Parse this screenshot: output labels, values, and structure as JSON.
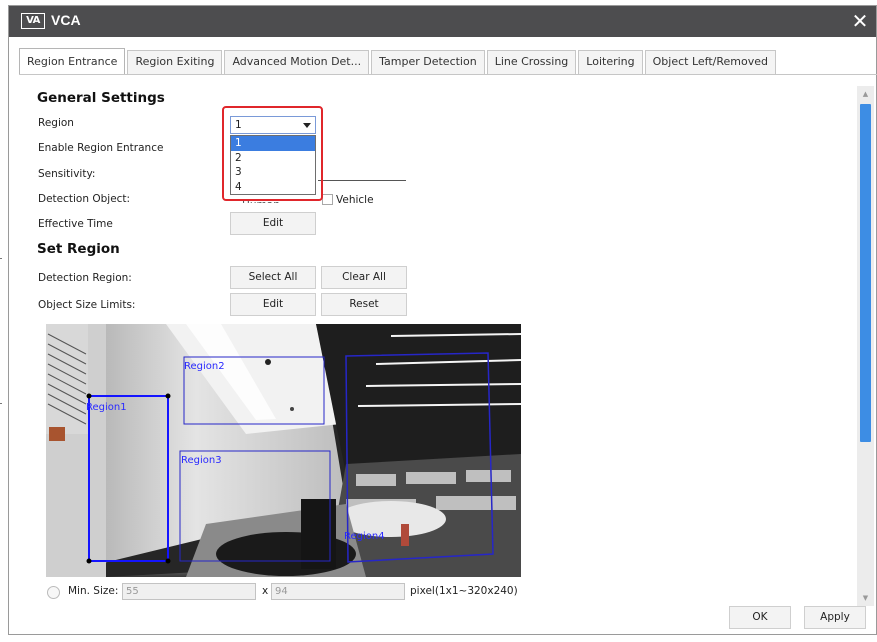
{
  "window": {
    "logo": "VA",
    "title": "VCA",
    "close_glyph": "✕"
  },
  "tabs": [
    {
      "label": "Region Entrance",
      "active": true
    },
    {
      "label": "Region Exiting",
      "active": false
    },
    {
      "label": "Advanced Motion Det...",
      "active": false
    },
    {
      "label": "Tamper Detection",
      "active": false
    },
    {
      "label": "Line Crossing",
      "active": false
    },
    {
      "label": "Loitering",
      "active": false
    },
    {
      "label": "Object Left/Removed",
      "active": false
    }
  ],
  "general": {
    "heading": "General Settings",
    "region_label": "Region",
    "region_value": "1",
    "region_options": [
      "1",
      "2",
      "3",
      "4"
    ],
    "enable_label": "Enable Region Entrance",
    "sensitivity_label": "Sensitivity:",
    "detection_object_label": "Detection Object:",
    "human_label": "Human",
    "vehicle_label": "Vehicle",
    "effective_time_label": "Effective Time",
    "edit_label": "Edit"
  },
  "set_region": {
    "heading": "Set Region",
    "detection_region_label": "Detection Region:",
    "select_all_label": "Select All",
    "clear_all_label": "Clear All",
    "object_size_label": "Object Size Limits:",
    "edit_label": "Edit",
    "reset_label": "Reset"
  },
  "video": {
    "regions": [
      {
        "name": "Region1",
        "color": "#1414ff",
        "active": true
      },
      {
        "name": "Region2",
        "color": "#2626c8",
        "active": false
      },
      {
        "name": "Region3",
        "color": "#2626c8",
        "active": false
      },
      {
        "name": "Region4",
        "color": "#2626c8",
        "active": false
      }
    ]
  },
  "size": {
    "min_label": "Min. Size:",
    "min_w": "55",
    "min_h": "94",
    "x_sep": "x",
    "pixel_hint": "pixel(1x1~320x240)"
  },
  "footer": {
    "ok_label": "OK",
    "apply_label": "Apply"
  },
  "colors": {
    "titlebar": "#4d4d4f",
    "scroll_thumb": "#3d8de4",
    "highlight_box": "#e0262b",
    "selected_option": "#3b7de0"
  }
}
